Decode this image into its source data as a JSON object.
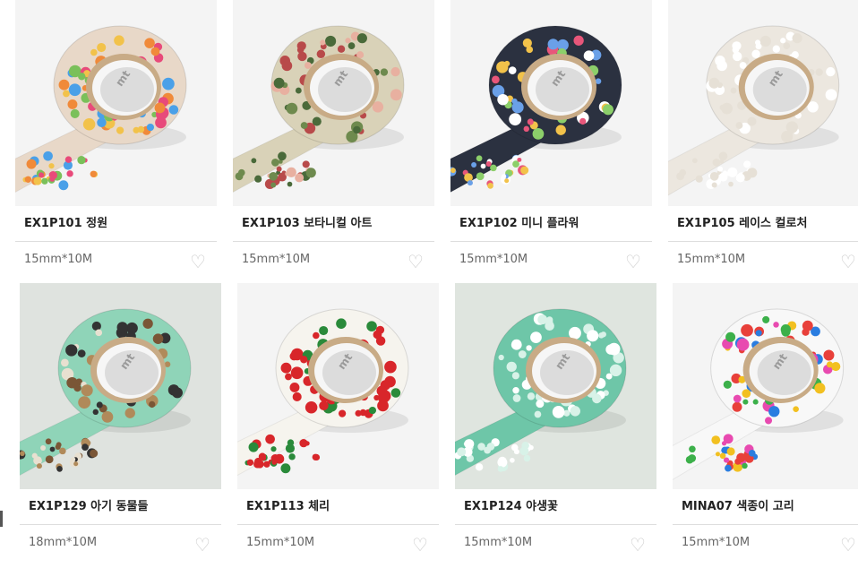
{
  "products": [
    {
      "name": "EX1P101 정원",
      "size": "15mm*10M",
      "pattern": "floral-colorful",
      "bg": "#f4f4f4",
      "tape": "#e8d8c8",
      "accent": "#e84a7a",
      "heart_icon": "heart-outline-icon"
    },
    {
      "name": "EX1P103 보타니컬 아트",
      "size": "15mm*10M",
      "pattern": "botanical",
      "bg": "#f4f4f4",
      "tape": "#d9d2b8",
      "accent": "#b44a4a",
      "heart_icon": "heart-outline-icon"
    },
    {
      "name": "EX1P102 미니 플라워",
      "size": "15mm*10M",
      "pattern": "mini-flower-dark",
      "bg": "#f4f4f4",
      "tape": "#2b3140",
      "accent": "#f0a040",
      "heart_icon": "heart-outline-icon"
    },
    {
      "name": "EX1P105 레이스 컬로처",
      "size": "15mm*10M",
      "pattern": "lace",
      "bg": "#f4f4f4",
      "tape": "#ece7df",
      "accent": "#c23a4a",
      "heart_icon": "heart-outline-icon"
    },
    {
      "name": "EX1P129 아기 동물들",
      "size": "18mm*10M",
      "pattern": "baby-animals",
      "bg": "#dfe3df",
      "tape": "#8fd4b8",
      "accent": "#6b4a2e",
      "heart_icon": "heart-outline-icon"
    },
    {
      "name": "EX1P113 체리",
      "size": "15mm*10M",
      "pattern": "cherry",
      "bg": "#f4f4f4",
      "tape": "#f6f4ee",
      "accent": "#d8262a",
      "heart_icon": "heart-outline-icon"
    },
    {
      "name": "EX1P124 야생꽃",
      "size": "15mm*10M",
      "pattern": "wildflower-mint",
      "bg": "#dfe5df",
      "tape": "#6ec6a8",
      "accent": "#ffffff",
      "heart_icon": "heart-outline-icon"
    },
    {
      "name": "MINA07 색종이 고리",
      "size": "15mm*10M",
      "pattern": "paper-chain",
      "bg": "#f4f4f4",
      "tape": "#f8f8f8",
      "accent": "#2a7de0",
      "heart_icon": "heart-outline-icon"
    }
  ],
  "tape_label": "mt"
}
